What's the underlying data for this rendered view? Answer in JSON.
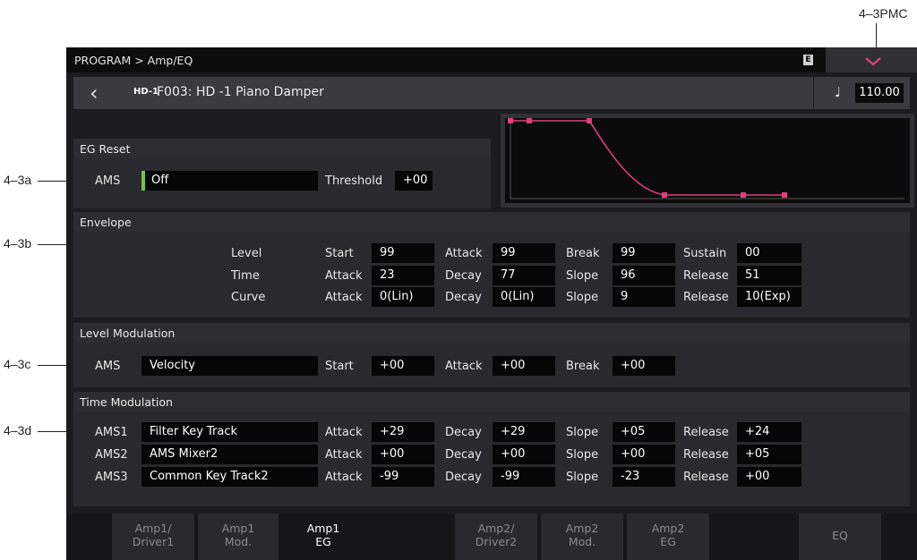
{
  "callouts": {
    "pmc": "4–3PMC",
    "a": "4–3a",
    "b": "4–3b",
    "c": "4–3c",
    "d": "4–3d"
  },
  "topbar": {
    "breadcrumb": "PROGRAM > Amp/EQ",
    "badge": "E",
    "chevron": "⌄"
  },
  "header": {
    "back": "‹",
    "logo": "HD-1",
    "program_name": "F003: HD -1 Piano Damper",
    "note_icon": "♩",
    "tempo": "110.00"
  },
  "eg_reset": {
    "title": "EG Reset",
    "ams_label": "AMS",
    "ams_value": "Off",
    "threshold_label": "Threshold",
    "threshold_value": "+00"
  },
  "envelope": {
    "title": "Envelope",
    "rows": [
      {
        "label": "Level",
        "cells": [
          [
            "Start",
            "99"
          ],
          [
            "Attack",
            "99"
          ],
          [
            "Break",
            "99"
          ],
          [
            "Sustain",
            "00"
          ]
        ]
      },
      {
        "label": "Time",
        "cells": [
          [
            "Attack",
            "23"
          ],
          [
            "Decay",
            "77"
          ],
          [
            "Slope",
            "96"
          ],
          [
            "Release",
            "51"
          ]
        ]
      },
      {
        "label": "Curve",
        "cells": [
          [
            "Attack",
            "0(Lin)"
          ],
          [
            "Decay",
            "0(Lin)"
          ],
          [
            "Slope",
            "9"
          ],
          [
            "Release",
            "10(Exp)"
          ]
        ]
      }
    ]
  },
  "level_mod": {
    "title": "Level Modulation",
    "ams_label": "AMS",
    "ams_value": "Velocity",
    "cells": [
      [
        "Start",
        "+00"
      ],
      [
        "Attack",
        "+00"
      ],
      [
        "Break",
        "+00"
      ]
    ]
  },
  "time_mod": {
    "title": "Time Modulation",
    "rows": [
      {
        "label": "AMS1",
        "source": "Filter Key Track",
        "cells": [
          [
            "Attack",
            "+29"
          ],
          [
            "Decay",
            "+29"
          ],
          [
            "Slope",
            "+05"
          ],
          [
            "Release",
            "+24"
          ]
        ]
      },
      {
        "label": "AMS2",
        "source": "AMS Mixer2",
        "cells": [
          [
            "Attack",
            "+00"
          ],
          [
            "Decay",
            "+00"
          ],
          [
            "Slope",
            "+00"
          ],
          [
            "Release",
            "+05"
          ]
        ]
      },
      {
        "label": "AMS3",
        "source": "Common Key Track2",
        "cells": [
          [
            "Attack",
            "-99"
          ],
          [
            "Decay",
            "-99"
          ],
          [
            "Slope",
            "-23"
          ],
          [
            "Release",
            "+00"
          ]
        ]
      }
    ]
  },
  "tabs": [
    {
      "line1": "Amp1/",
      "line2": "Driver1",
      "active": false
    },
    {
      "line1": "Amp1",
      "line2": "Mod.",
      "active": false
    },
    {
      "line1": "Amp1",
      "line2": "EG",
      "active": true
    },
    {
      "line1": "Amp2/",
      "line2": "Driver2",
      "active": false
    },
    {
      "line1": "Amp2",
      "line2": "Mod.",
      "active": false
    },
    {
      "line1": "Amp2",
      "line2": "EG",
      "active": false
    },
    {
      "line1": "EQ",
      "line2": "",
      "active": false
    }
  ],
  "colors": {
    "accent": "#e0407e",
    "ams_indicator": "#7cc04a",
    "screen_bg": "#1c1c1e"
  }
}
